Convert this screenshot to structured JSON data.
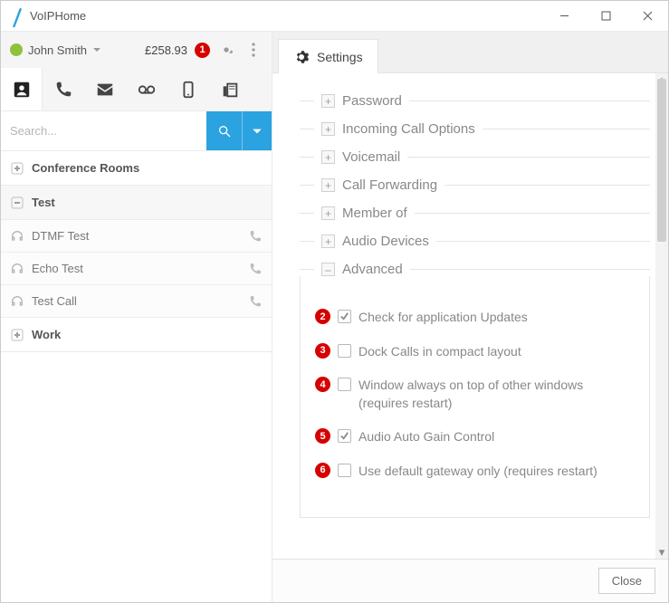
{
  "window": {
    "title": "VoIPHome"
  },
  "user": {
    "name": "John Smith",
    "balance": "£258.93",
    "badge": "1"
  },
  "search": {
    "placeholder": "Search..."
  },
  "groups": {
    "conference": "Conference Rooms",
    "test": "Test",
    "work": "Work"
  },
  "contacts": {
    "dtmf": "DTMF Test",
    "echo": "Echo Test",
    "testcall": "Test Call"
  },
  "settings": {
    "tab": "Settings",
    "sections": {
      "password": "Password",
      "incoming": "Incoming Call Options",
      "voicemail": "Voicemail",
      "forwarding": "Call Forwarding",
      "memberof": "Member of",
      "audiodev": "Audio Devices",
      "advanced": "Advanced"
    },
    "advanced_options": {
      "opt2": {
        "num": "2",
        "label": "Check for application Updates",
        "checked": true
      },
      "opt3": {
        "num": "3",
        "label": "Dock Calls in compact layout",
        "checked": false
      },
      "opt4": {
        "num": "4",
        "label": "Window always on top of other windows (requires restart)",
        "checked": false
      },
      "opt5": {
        "num": "5",
        "label": "Audio Auto Gain Control",
        "checked": true
      },
      "opt6": {
        "num": "6",
        "label": "Use default gateway only (requires restart)",
        "checked": false
      }
    },
    "close": "Close"
  }
}
